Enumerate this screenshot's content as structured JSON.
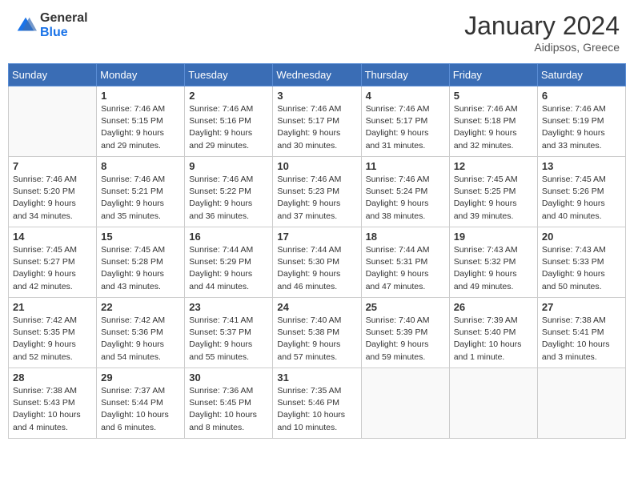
{
  "header": {
    "logo_general": "General",
    "logo_blue": "Blue",
    "month_title": "January 2024",
    "location": "Aidipsos, Greece"
  },
  "calendar": {
    "days_of_week": [
      "Sunday",
      "Monday",
      "Tuesday",
      "Wednesday",
      "Thursday",
      "Friday",
      "Saturday"
    ],
    "weeks": [
      [
        {
          "day": "",
          "empty": true
        },
        {
          "day": "1",
          "sunrise": "7:46 AM",
          "sunset": "5:15 PM",
          "daylight": "9 hours and 29 minutes."
        },
        {
          "day": "2",
          "sunrise": "7:46 AM",
          "sunset": "5:16 PM",
          "daylight": "9 hours and 29 minutes."
        },
        {
          "day": "3",
          "sunrise": "7:46 AM",
          "sunset": "5:17 PM",
          "daylight": "9 hours and 30 minutes."
        },
        {
          "day": "4",
          "sunrise": "7:46 AM",
          "sunset": "5:17 PM",
          "daylight": "9 hours and 31 minutes."
        },
        {
          "day": "5",
          "sunrise": "7:46 AM",
          "sunset": "5:18 PM",
          "daylight": "9 hours and 32 minutes."
        },
        {
          "day": "6",
          "sunrise": "7:46 AM",
          "sunset": "5:19 PM",
          "daylight": "9 hours and 33 minutes."
        }
      ],
      [
        {
          "day": "7",
          "sunrise": "7:46 AM",
          "sunset": "5:20 PM",
          "daylight": "9 hours and 34 minutes."
        },
        {
          "day": "8",
          "sunrise": "7:46 AM",
          "sunset": "5:21 PM",
          "daylight": "9 hours and 35 minutes."
        },
        {
          "day": "9",
          "sunrise": "7:46 AM",
          "sunset": "5:22 PM",
          "daylight": "9 hours and 36 minutes."
        },
        {
          "day": "10",
          "sunrise": "7:46 AM",
          "sunset": "5:23 PM",
          "daylight": "9 hours and 37 minutes."
        },
        {
          "day": "11",
          "sunrise": "7:46 AM",
          "sunset": "5:24 PM",
          "daylight": "9 hours and 38 minutes."
        },
        {
          "day": "12",
          "sunrise": "7:45 AM",
          "sunset": "5:25 PM",
          "daylight": "9 hours and 39 minutes."
        },
        {
          "day": "13",
          "sunrise": "7:45 AM",
          "sunset": "5:26 PM",
          "daylight": "9 hours and 40 minutes."
        }
      ],
      [
        {
          "day": "14",
          "sunrise": "7:45 AM",
          "sunset": "5:27 PM",
          "daylight": "9 hours and 42 minutes."
        },
        {
          "day": "15",
          "sunrise": "7:45 AM",
          "sunset": "5:28 PM",
          "daylight": "9 hours and 43 minutes."
        },
        {
          "day": "16",
          "sunrise": "7:44 AM",
          "sunset": "5:29 PM",
          "daylight": "9 hours and 44 minutes."
        },
        {
          "day": "17",
          "sunrise": "7:44 AM",
          "sunset": "5:30 PM",
          "daylight": "9 hours and 46 minutes."
        },
        {
          "day": "18",
          "sunrise": "7:44 AM",
          "sunset": "5:31 PM",
          "daylight": "9 hours and 47 minutes."
        },
        {
          "day": "19",
          "sunrise": "7:43 AM",
          "sunset": "5:32 PM",
          "daylight": "9 hours and 49 minutes."
        },
        {
          "day": "20",
          "sunrise": "7:43 AM",
          "sunset": "5:33 PM",
          "daylight": "9 hours and 50 minutes."
        }
      ],
      [
        {
          "day": "21",
          "sunrise": "7:42 AM",
          "sunset": "5:35 PM",
          "daylight": "9 hours and 52 minutes."
        },
        {
          "day": "22",
          "sunrise": "7:42 AM",
          "sunset": "5:36 PM",
          "daylight": "9 hours and 54 minutes."
        },
        {
          "day": "23",
          "sunrise": "7:41 AM",
          "sunset": "5:37 PM",
          "daylight": "9 hours and 55 minutes."
        },
        {
          "day": "24",
          "sunrise": "7:40 AM",
          "sunset": "5:38 PM",
          "daylight": "9 hours and 57 minutes."
        },
        {
          "day": "25",
          "sunrise": "7:40 AM",
          "sunset": "5:39 PM",
          "daylight": "9 hours and 59 minutes."
        },
        {
          "day": "26",
          "sunrise": "7:39 AM",
          "sunset": "5:40 PM",
          "daylight": "10 hours and 1 minute."
        },
        {
          "day": "27",
          "sunrise": "7:38 AM",
          "sunset": "5:41 PM",
          "daylight": "10 hours and 3 minutes."
        }
      ],
      [
        {
          "day": "28",
          "sunrise": "7:38 AM",
          "sunset": "5:43 PM",
          "daylight": "10 hours and 4 minutes."
        },
        {
          "day": "29",
          "sunrise": "7:37 AM",
          "sunset": "5:44 PM",
          "daylight": "10 hours and 6 minutes."
        },
        {
          "day": "30",
          "sunrise": "7:36 AM",
          "sunset": "5:45 PM",
          "daylight": "10 hours and 8 minutes."
        },
        {
          "day": "31",
          "sunrise": "7:35 AM",
          "sunset": "5:46 PM",
          "daylight": "10 hours and 10 minutes."
        },
        {
          "day": "",
          "empty": true
        },
        {
          "day": "",
          "empty": true
        },
        {
          "day": "",
          "empty": true
        }
      ]
    ],
    "labels": {
      "sunrise": "Sunrise:",
      "sunset": "Sunset:",
      "daylight": "Daylight:"
    }
  }
}
